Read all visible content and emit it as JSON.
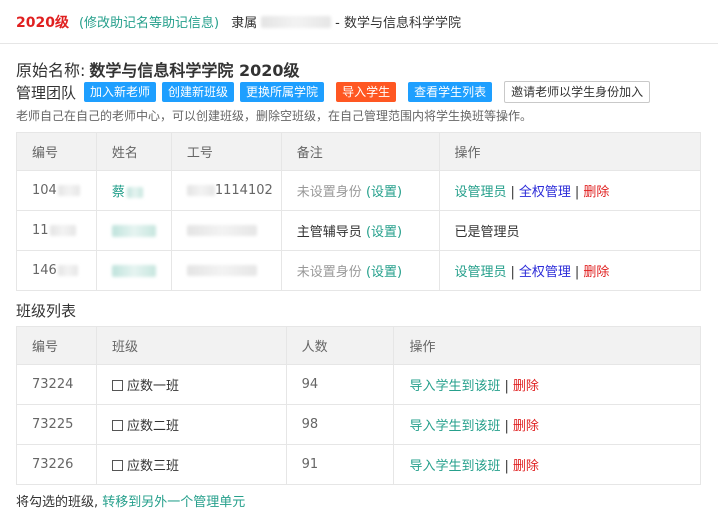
{
  "header": {
    "year": "2020级",
    "edit_link": "(修改助记名等助记信息)",
    "belong_prefix": "隶属",
    "college_suffix": "- 数学与信息科学学院"
  },
  "original": {
    "label": "原始名称:",
    "value": "数学与信息科学学院 2020级"
  },
  "management": {
    "label": "管理团队",
    "buttons": {
      "add_teacher": "加入新老师",
      "create_class": "创建新班级",
      "change_college": "更换所属学院",
      "import_students": "导入学生",
      "view_students": "查看学生列表",
      "invite_teacher": "邀请老师以学生身份加入"
    },
    "hint": "老师自己在自己的老师中心，可以创建班级，删除空班级，在自己管理范围内将学生换班等操作。"
  },
  "team_table": {
    "headers": [
      "编号",
      "姓名",
      "工号",
      "备注",
      "操作"
    ],
    "rows": [
      {
        "id": "104",
        "name": "蔡",
        "work_id": "1114102",
        "remark": "未设置身份",
        "remark_link": "(设置)",
        "actions": [
          "设管理员",
          "全权管理",
          "删除"
        ]
      },
      {
        "id": "11",
        "name": "",
        "work_id": "",
        "remark": "主管辅导员",
        "remark_link": "(设置)",
        "status": "已是管理员"
      },
      {
        "id": "146",
        "name": "",
        "work_id": "",
        "remark": "未设置身份",
        "remark_link": "(设置)",
        "actions": [
          "设管理员",
          "全权管理",
          "删除"
        ]
      }
    ]
  },
  "class_section": {
    "title": "班级列表",
    "headers": [
      "编号",
      "班级",
      "人数",
      "操作"
    ],
    "rows": [
      {
        "id": "73224",
        "name": "应数一班",
        "count": "94",
        "import": "导入学生到该班",
        "delete": "删除"
      },
      {
        "id": "73225",
        "name": "应数二班",
        "count": "98",
        "import": "导入学生到该班",
        "delete": "删除"
      },
      {
        "id": "73226",
        "name": "应数三班",
        "count": "91",
        "import": "导入学生到该班",
        "delete": "删除"
      }
    ]
  },
  "footer": {
    "text": "将勾选的班级,",
    "link": "转移到另外一个管理单元"
  },
  "colors": {
    "teal_link": "#26a08c",
    "red": "#e02020",
    "button_blue": "#1e9fff",
    "button_orange": "#ff5722",
    "navy_link": "#2b2bd8"
  }
}
